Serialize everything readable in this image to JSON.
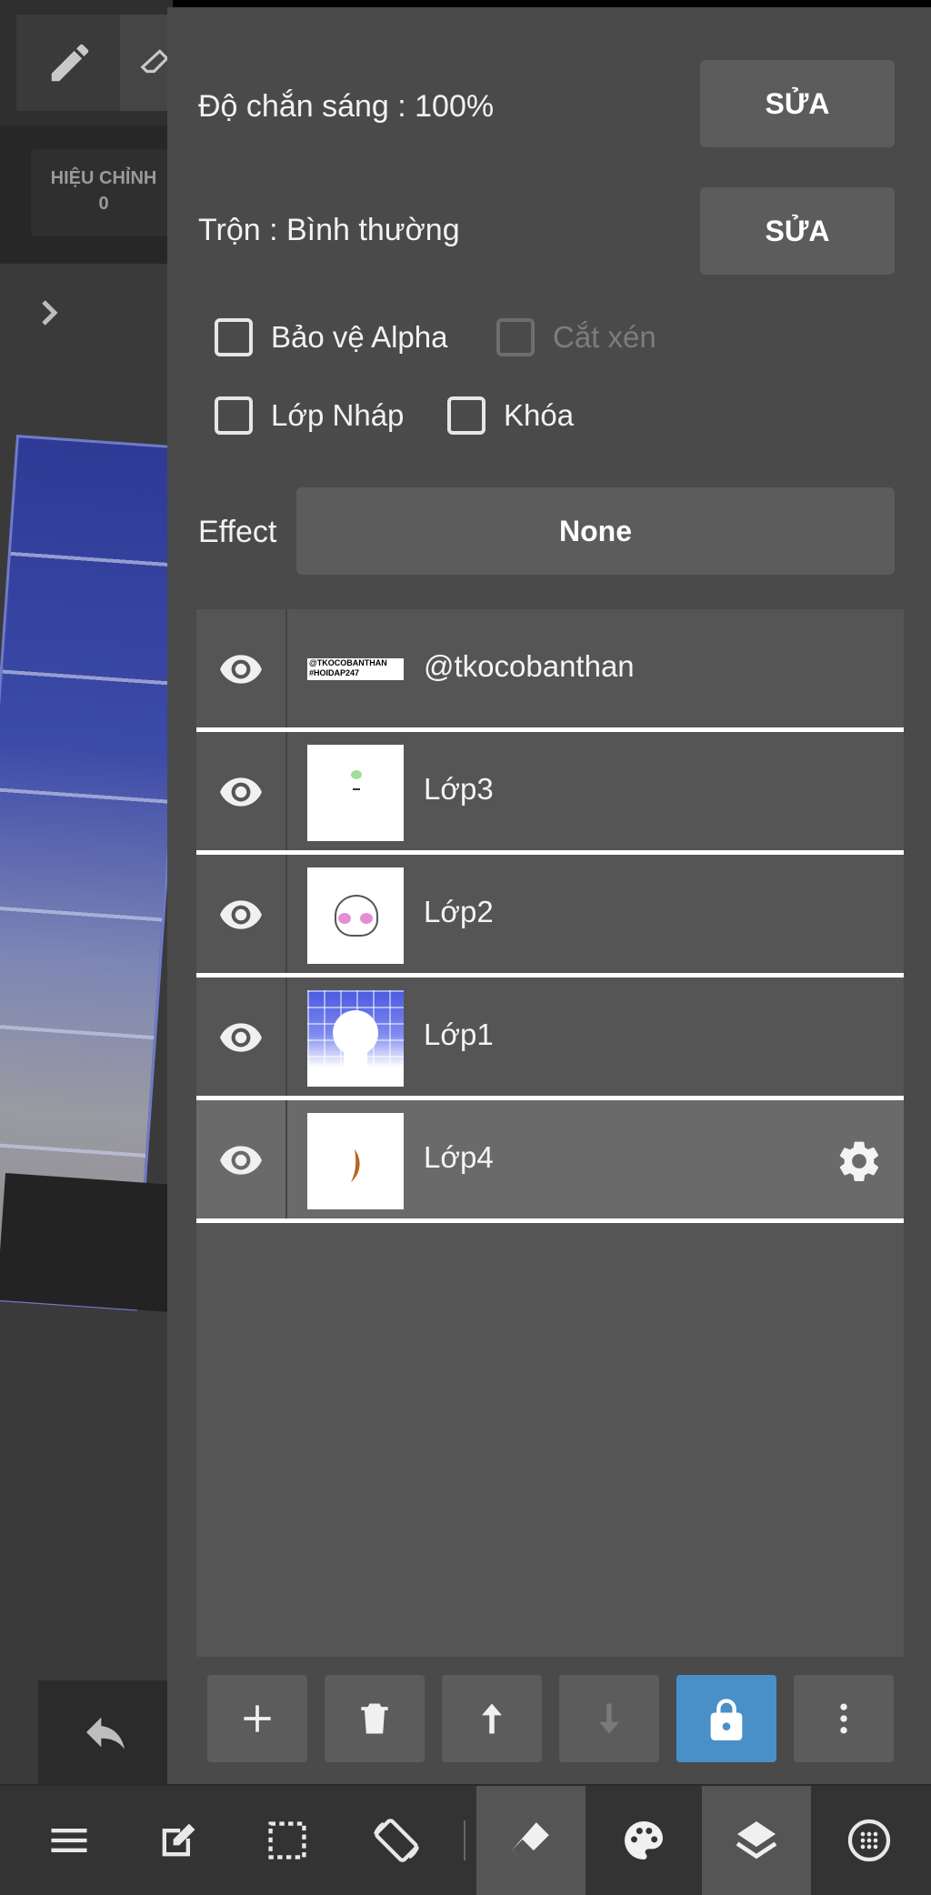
{
  "left": {
    "adjust_title": "HIỆU CHỈNH",
    "adjust_value": "0"
  },
  "panel": {
    "opacity_label": "Độ chắn sáng : 100%",
    "opacity_edit": "SỬA",
    "blend_label": "Trộn : Bình thường",
    "blend_edit": "SỬA",
    "alpha_protect": "Bảo vệ Alpha",
    "clipping": "Cắt xén",
    "draft_layer": "Lớp Nháp",
    "lock": "Khóa",
    "effect_label": "Effect",
    "effect_value": "None"
  },
  "layers": [
    {
      "name": "@tkocobanthan",
      "thumb_text_1": "@TKOCOBANTHAN",
      "thumb_text_2": "#HOIDAP247"
    },
    {
      "name": "Lớp3"
    },
    {
      "name": "Lớp2"
    },
    {
      "name": "Lớp1"
    },
    {
      "name": "Lớp4",
      "selected": true
    }
  ],
  "colors": {
    "panel_bg": "#4a4a4a",
    "button_bg": "#5c5c5c",
    "lock_active": "#4a90c8",
    "list_bg": "#555555",
    "selected_bg": "#6a6a6a"
  }
}
